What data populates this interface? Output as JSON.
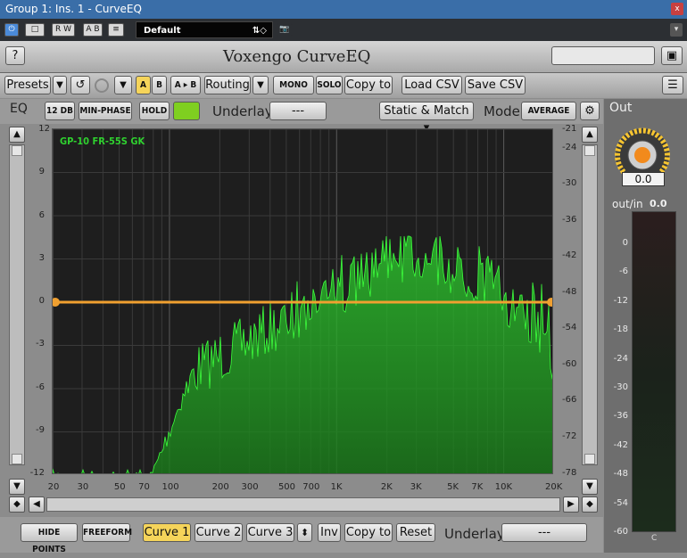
{
  "window": {
    "title": "Group 1: Ins. 1 - CurveEQ",
    "close": "x"
  },
  "host": {
    "preset_name": "Default",
    "rw_label": "R W",
    "ab_label": "A B"
  },
  "plugin": {
    "title": "Voxengo CurveEQ"
  },
  "toolbar": {
    "presets": "Presets",
    "a": "A",
    "b": "B",
    "ab_copy": "A ▸ B",
    "routing": "Routing",
    "mono": "MONO",
    "solo": "SOLO",
    "copy_to": "Copy to",
    "load_csv": "Load CSV",
    "save_csv": "Save CSV"
  },
  "eqbar": {
    "eq": "EQ",
    "range": "12 DB",
    "min_phase": "MIN-PHASE",
    "hold": "HOLD",
    "underlay": "Underlay",
    "underlay_value": "---",
    "static_match": "Static & Match",
    "mode": "Mode",
    "mode_value": "AVERAGE"
  },
  "graph": {
    "spectrum_label": "GP-10 FR-55S GK",
    "left_ticks": [
      "12",
      "9",
      "6",
      "3",
      "0",
      "-3",
      "-6",
      "-9",
      "-12"
    ],
    "right_ticks": [
      "-21",
      "-24",
      "-30",
      "-36",
      "-42",
      "-48",
      "-54",
      "-60",
      "-66",
      "-72",
      "-78"
    ],
    "freq_ticks": [
      "20",
      "30",
      "50",
      "70",
      "100",
      "200",
      "300",
      "500",
      "700",
      "1K",
      "2K",
      "3K",
      "5K",
      "7K",
      "10K",
      "20K"
    ]
  },
  "out": {
    "title": "Out",
    "knob_value": "0.0",
    "outin_label": "out/in",
    "outin_value": "0.0",
    "meter_ticks": [
      "0",
      "-6",
      "-12",
      "-18",
      "-24",
      "-30",
      "-36",
      "-42",
      "-48",
      "-54",
      "-60"
    ],
    "channel": "C"
  },
  "bottom": {
    "hide_points": "HIDE POINTS",
    "freeform": "FREEFORM",
    "curve1": "Curve 1",
    "curve2": "Curve 2",
    "curve3": "Curve 3",
    "inv": "Inv",
    "copy_to": "Copy to",
    "reset": "Reset",
    "underlay": "Underlay",
    "underlay_value": "---"
  },
  "colors": {
    "accent": "#f5d45a",
    "curve": "#f0a030",
    "spectrum": "#2fd12f",
    "hold_led": "#7fcf20"
  }
}
